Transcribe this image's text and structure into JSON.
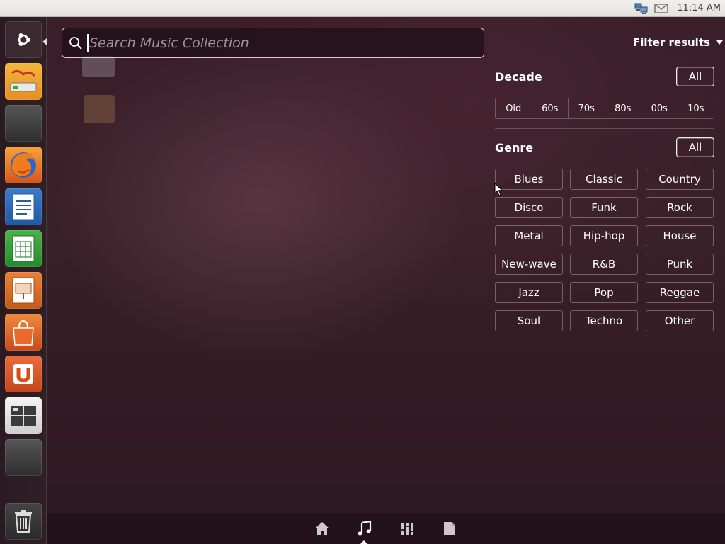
{
  "top_panel": {
    "clock": "11:14 AM",
    "icons": [
      "network-icon",
      "mail-icon"
    ]
  },
  "launcher": {
    "items": [
      {
        "name": "dash-home",
        "icon": "ubuntu-logo-icon"
      },
      {
        "name": "installer",
        "icon": "installer-icon"
      },
      {
        "name": "blank-1",
        "icon": "blank-icon"
      },
      {
        "name": "firefox",
        "icon": "firefox-icon"
      },
      {
        "name": "libreoffice-writer",
        "icon": "writer-icon"
      },
      {
        "name": "libreoffice-calc",
        "icon": "calc-icon"
      },
      {
        "name": "libreoffice-impress",
        "icon": "impress-icon"
      },
      {
        "name": "software-center",
        "icon": "bag-icon"
      },
      {
        "name": "ubuntu-one",
        "icon": "ubuntu-one-icon"
      },
      {
        "name": "workspaces",
        "icon": "workspace-icon"
      },
      {
        "name": "blank-2",
        "icon": "blank-icon"
      },
      {
        "name": "trash",
        "icon": "trash-icon"
      }
    ]
  },
  "search": {
    "placeholder": "Search Music Collection",
    "value": ""
  },
  "filter": {
    "header": "Filter results",
    "decade": {
      "title": "Decade",
      "all_label": "All",
      "options": [
        "Old",
        "60s",
        "70s",
        "80s",
        "00s",
        "10s"
      ]
    },
    "genre": {
      "title": "Genre",
      "all_label": "All",
      "options": [
        "Blues",
        "Classic",
        "Country",
        "Disco",
        "Funk",
        "Rock",
        "Metal",
        "Hip-hop",
        "House",
        "New-wave",
        "R&B",
        "Punk",
        "Jazz",
        "Pop",
        "Reggae",
        "Soul",
        "Techno",
        "Other"
      ]
    }
  },
  "lenses": [
    {
      "name": "home-lens",
      "icon": "home-icon"
    },
    {
      "name": "music-lens",
      "icon": "music-icon",
      "active": true
    },
    {
      "name": "applications-lens",
      "icon": "applications-icon"
    },
    {
      "name": "files-lens",
      "icon": "file-icon"
    }
  ]
}
